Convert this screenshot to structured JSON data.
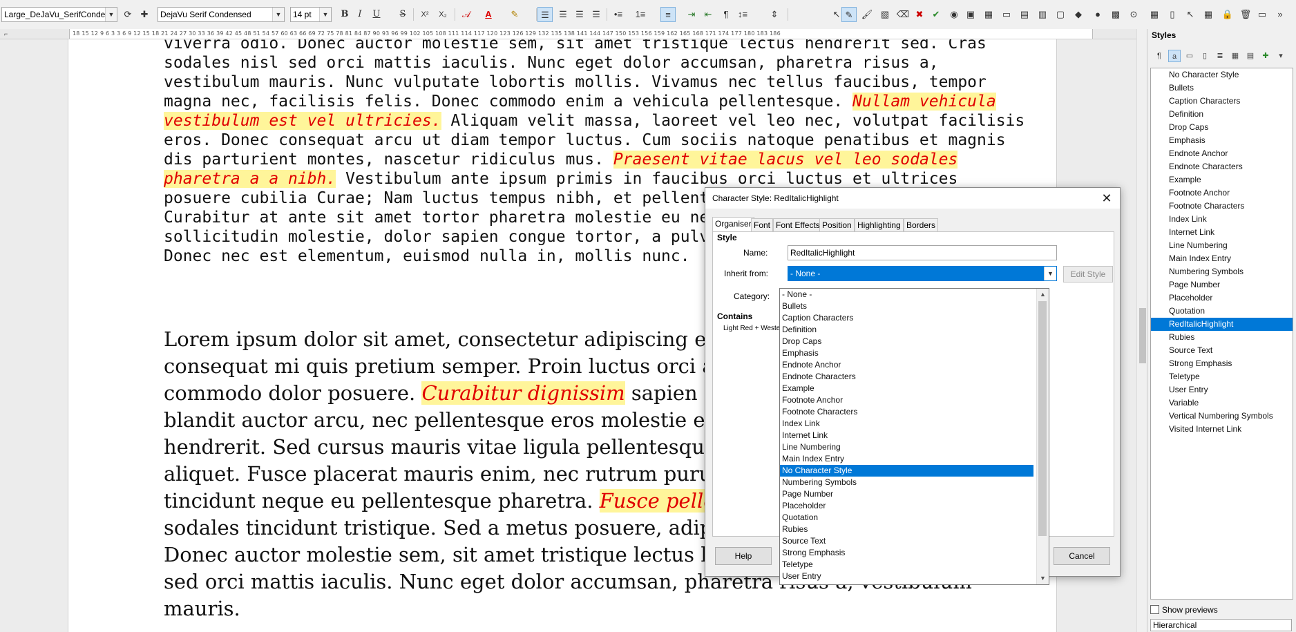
{
  "toolbar": {
    "paragraph_style": "Large_DeJaVu_SerifCondens",
    "font_name": "DejaVu Serif Condensed",
    "font_size": "14 pt",
    "bold_label": "B",
    "italic_label": "I",
    "underline_label": "U",
    "strike_label": "S",
    "superscript_label": "X²",
    "subscript_label": "X₂"
  },
  "ruler": {
    "marks": "18   15   12   9   6   3        3   6   9   12   15   18   21   24   27   30   33   36   39   42   45   48   51   54   57   60   63   66   69   72   75   78   81   84   87   90   93   96   99  102 105 108 111 114 117 120 123 126 129 132 135 138 141 144 147 150 153 156 159 162 165 168 171 174 177 180 183 186"
  },
  "document": {
    "p1": {
      "t1": "viverra odio. Donec auctor molestie sem, sit amet tristique lectus hendrerit sed. Cras sodales nisl sed orci mattis iaculis. Nunc eget dolor accumsan, pharetra risus a, vestibulum mauris. Nunc vulputate lobortis mollis. Vivamus nec tellus faucibus, tempor magna nec, facilisis felis. Donec commodo enim a vehicula pellentesque. ",
      "h1": "Nullam vehicula vestibulum est vel ultricies.",
      "t2": " Aliquam velit massa, laoreet vel leo nec, volutpat facilisis eros. Donec consequat arcu ut diam tempor luctus. Cum sociis natoque penatibus et magnis dis parturient montes, nascetur ridiculus mus. ",
      "h2": "Praesent vitae lacus vel leo sodales pharetra a a nibh.",
      "t3": " Vestibulum ante ipsum primis in faucibus orci luctus et ultrices posuere cubilia Curae; Nam luctus tempus nibh, et pellentesque ante consectetur eget. Curabitur at ante sit amet tortor pharetra molestie eu nec ante. Mauris tincidunt, nibh eu sollicitudin molestie, dolor sapien congue tortor, a pulvinar sapien turpis sed ante. Donec nec est elementum, euismod nulla in, mollis nunc."
    },
    "p2": {
      "t1": "Lorem ipsum dolor sit amet, consectetur adipiscing elit. Ut a sapien. Aliquam consequat mi quis pretium semper. Proin luctus orci ac neque venenatis, quis commodo dolor posuere. ",
      "h1": "Curabitur dignissim",
      "t2": " sapien quis cursus egestas. Donec blandit auctor arcu, nec pellentesque eros molestie eget. In consectetur aliquam hendrerit. Sed cursus mauris vitae ligula pellentesque, non pellentesque urna aliquet. Fusce placerat mauris enim, nec rutrum purus semper vel. Praesent tincidunt neque eu pellentesque pharetra. ",
      "h2": "Fusce pellentesque est orci.",
      "t3": " Integer sodales tincidunt tristique. Sed a metus posuere, adipiscing nunc et, viverra odio. Donec auctor molestie sem, sit amet tristique lectus hendrerit sed. Cras sodales nisl sed orci mattis iaculis. Nunc eget dolor accumsan, pharetra risus a, vestibulum mauris."
    }
  },
  "dialog": {
    "title": "Character Style: RedItalicHighlight",
    "close_glyph": "✕",
    "tabs": [
      "Organiser",
      "Font",
      "Font Effects",
      "Position",
      "Highlighting",
      "Borders"
    ],
    "section_style": "Style",
    "name_label": "Name:",
    "name_value": "RedItalicHighlight",
    "inherit_label": "Inherit from:",
    "inherit_value": "- None -",
    "edit_style": "Edit Style",
    "category_label": "Category:",
    "contains_label": "Contains",
    "contains_value": "Light Red + Western text: Italic + Highlighting",
    "help": "Help",
    "cancel": "Cancel"
  },
  "dropdown": {
    "items": [
      "- None -",
      "Bullets",
      "Caption Characters",
      "Definition",
      "Drop Caps",
      "Emphasis",
      "Endnote Anchor",
      "Endnote Characters",
      "Example",
      "Footnote Anchor",
      "Footnote Characters",
      "Index Link",
      "Internet Link",
      "Line Numbering",
      "Main Index Entry",
      "No Character Style",
      "Numbering Symbols",
      "Page Number",
      "Placeholder",
      "Quotation",
      "Rubies",
      "Source Text",
      "Strong Emphasis",
      "Teletype",
      "User Entry"
    ],
    "selected_index": 15
  },
  "sidebar": {
    "title": "Styles",
    "items": [
      "No Character Style",
      "Bullets",
      "Caption Characters",
      "Definition",
      "Drop Caps",
      "Emphasis",
      "Endnote Anchor",
      "Endnote Characters",
      "Example",
      "Footnote Anchor",
      "Footnote Characters",
      "Index Link",
      "Internet Link",
      "Line Numbering",
      "Main Index Entry",
      "Numbering Symbols",
      "Page Number",
      "Placeholder",
      "Quotation",
      "RedItalicHighlight",
      "Rubies",
      "Source Text",
      "Strong Emphasis",
      "Teletype",
      "User Entry",
      "Variable",
      "Vertical Numbering Symbols",
      "Visited Internet Link"
    ],
    "selected_index": 19,
    "show_previews": "Show previews",
    "filter": "Hierarchical"
  },
  "colors": {
    "highlight_bg": "#fff59a",
    "highlight_text": "#e00000",
    "selection": "#0078d7"
  }
}
